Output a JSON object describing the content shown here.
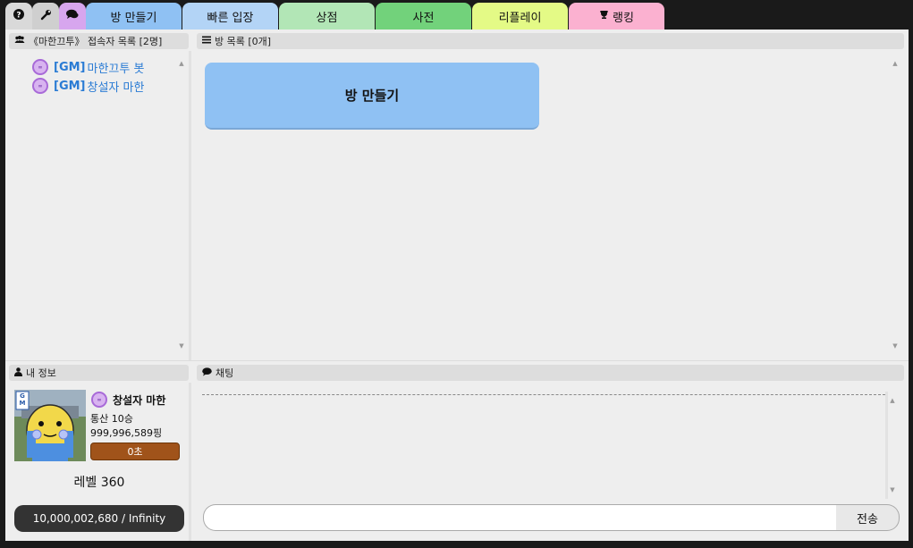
{
  "tabs": {
    "help_icon": "question-circle-icon",
    "settings_icon": "wrench-icon",
    "chat_icon": "comments-icon",
    "items": [
      {
        "label": "방 만들기",
        "color": "#8fc1f3"
      },
      {
        "label": "빠른 입장",
        "color": "#b3d4f6"
      },
      {
        "label": "상점",
        "color": "#b2e6b6"
      },
      {
        "label": "사전",
        "color": "#72d27b"
      },
      {
        "label": "리플레이",
        "color": "#e4fa86"
      },
      {
        "label": "랭킹",
        "color": "#fbb1d0",
        "icon": "trophy-icon"
      }
    ]
  },
  "users_panel": {
    "title": "《마한끄투》 접속자 목록 [2명]",
    "icon": "users-icon",
    "users": [
      {
        "tag": "[GM]",
        "name": "마한끄투 봇"
      },
      {
        "tag": "[GM]",
        "name": "창설자 마한"
      }
    ]
  },
  "rooms_panel": {
    "title": "방 목록 [0개]",
    "icon": "list-icon",
    "make_room_label": "방 만들기"
  },
  "my_info": {
    "title": "내 정보",
    "icon": "user-icon",
    "name": "창설자 마한",
    "record": "통산 10승",
    "ping": "999,996,589핑",
    "time": "0초",
    "level": "레벨 360",
    "exp": "10,000,002,680 / Infinity",
    "gm_mark": "GM"
  },
  "chat": {
    "title": "채팅",
    "icon": "comment-icon",
    "input_value": "",
    "send_label": "전송"
  }
}
